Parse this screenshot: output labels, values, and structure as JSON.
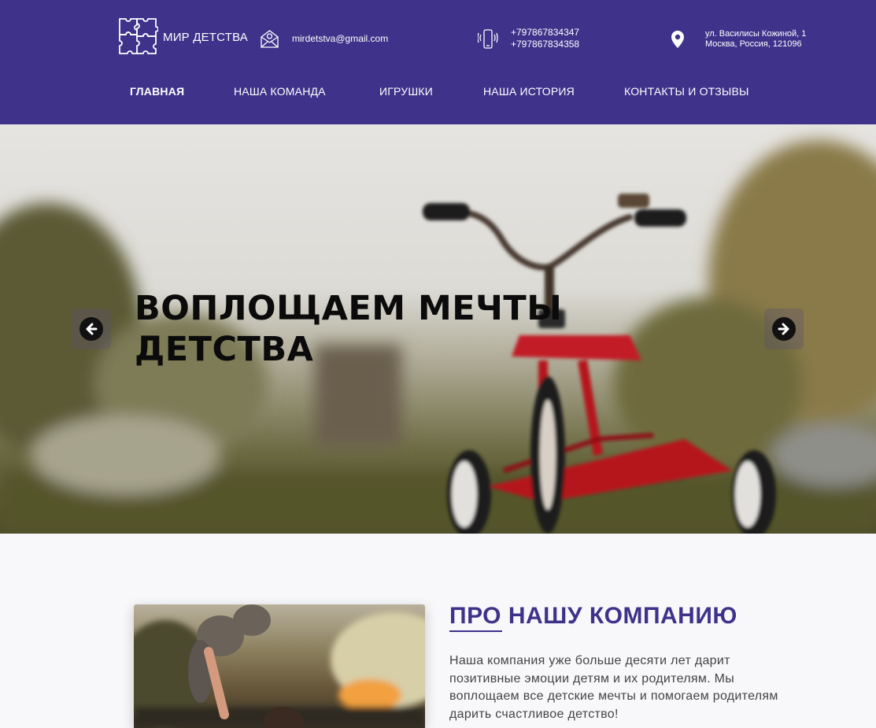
{
  "header": {
    "logo_text": "МИР ДЕТСТВА",
    "email": "mirdetstva@gmail.com",
    "phones": [
      "+797867834347",
      "+797867834358"
    ],
    "address_line1": "ул. Василисы Кожиной, 1",
    "address_line2": "Москва, Россия, 121096",
    "background_color": "#3f328a"
  },
  "nav": {
    "items": [
      {
        "label": "ГЛАВНАЯ",
        "active": true
      },
      {
        "label": "НАША КОМАНДА",
        "active": false
      },
      {
        "label": "ИГРУШКИ",
        "active": false
      },
      {
        "label": "НАША ИСТОРИЯ",
        "active": false
      },
      {
        "label": "КОНТАКТЫ И ОТЗЫВЫ",
        "active": false
      }
    ]
  },
  "hero": {
    "title_line1": "ВОПЛОЩАЕМ МЕЧТЫ",
    "title_line2": "ДЕТСТВА",
    "prev_icon": "arrow-left-icon",
    "next_icon": "arrow-right-icon"
  },
  "about": {
    "title": "ПРО НАШУ КОМПАНИЮ",
    "text": "Наша компания уже больше десяти лет дарит позитивные эмоции детям и их родителям. Мы воплощаем все детские мечты и помогаем родителям дарить счастливое детство!",
    "title_color": "#3f328a"
  }
}
